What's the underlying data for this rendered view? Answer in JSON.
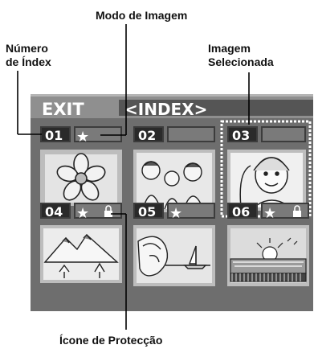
{
  "callouts": {
    "image_mode": "Modo de Imagem",
    "index_number": "Número\nde Índex",
    "selected_image": "Imagem\nSelecionada",
    "protect_icon": "Ícone de Protecção"
  },
  "screen": {
    "exit_label": "EXIT",
    "index_label": "<INDEX>",
    "thumbnails": [
      {
        "number": "01",
        "star": true,
        "lock": false,
        "selected": false,
        "picture": "flower"
      },
      {
        "number": "02",
        "star": false,
        "lock": false,
        "selected": false,
        "picture": "group-photo"
      },
      {
        "number": "03",
        "star": false,
        "lock": false,
        "selected": true,
        "picture": "portrait"
      },
      {
        "number": "04",
        "star": true,
        "lock": true,
        "selected": false,
        "picture": "mountains"
      },
      {
        "number": "05",
        "star": true,
        "lock": false,
        "selected": false,
        "picture": "beach-woman"
      },
      {
        "number": "06",
        "star": true,
        "lock": true,
        "selected": false,
        "picture": "sunset-sea"
      }
    ],
    "star_glyph": "★",
    "colors": {
      "screen_bg": "#6e6e6e",
      "header_bg": "#8a8a8a",
      "thumb_bg": "#d9d9d9",
      "label_bg": "#3c3c3c"
    }
  }
}
